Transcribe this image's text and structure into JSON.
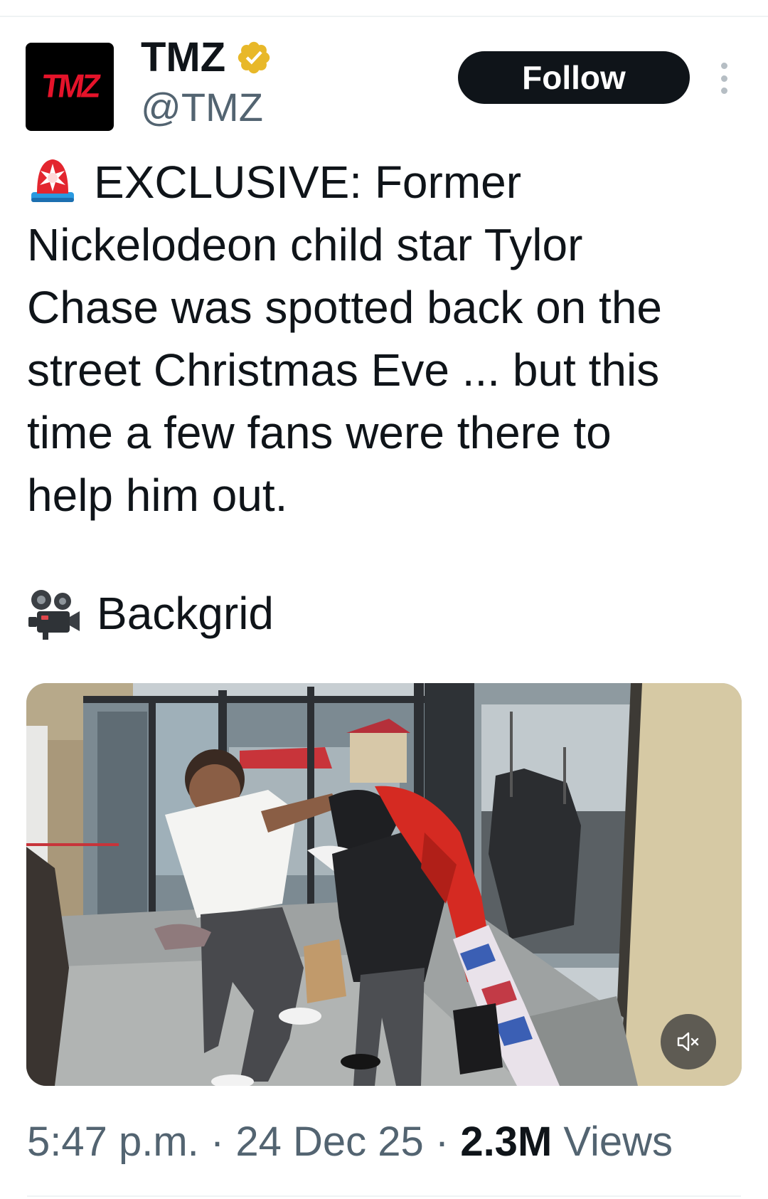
{
  "author": {
    "avatar_text": "TMZ",
    "display_name": "TMZ",
    "handle": "@TMZ",
    "verified": true,
    "verified_color": "#e8b829"
  },
  "actions": {
    "follow_label": "Follow",
    "more_icon": "more-vertical-icon"
  },
  "tweet": {
    "lines": [
      "EXCLUSIVE: Former",
      "Nickelodeon child star Tylor",
      "Chase was spotted back on the",
      "street Christmas Eve ... but this",
      "time a few fans were there to",
      "help him out."
    ],
    "lead_emoji": "police-light-icon",
    "credit_emoji": "movie-camera-icon",
    "credit": "Backgrid"
  },
  "media": {
    "type": "video",
    "mute_icon": "muted-speaker-icon"
  },
  "meta": {
    "time": "5:47 p.m.",
    "separator": " · ",
    "date": "24 Dec 25",
    "views_count": "2.3M",
    "views_label": "Views"
  },
  "colors": {
    "text": "#0f1419",
    "secondary": "#536471",
    "brand_red": "#e5132a"
  }
}
